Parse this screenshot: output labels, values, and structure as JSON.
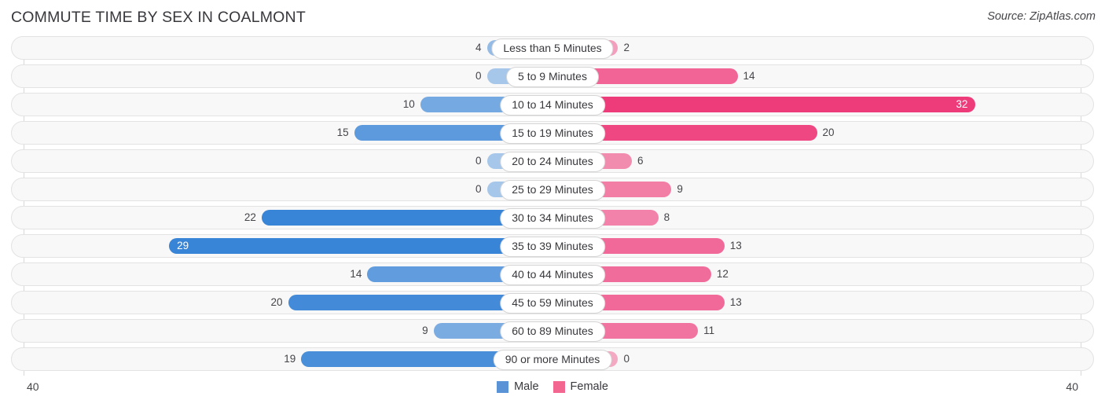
{
  "header": {
    "title": "COMMUTE TIME BY SEX IN COALMONT",
    "source": "Source: ZipAtlas.com"
  },
  "axis": {
    "left_tick": "40",
    "right_tick": "40",
    "max": 40
  },
  "legend": {
    "items": [
      {
        "label": "Male",
        "color": "#5b94d6",
        "swatch": "male-swatch"
      },
      {
        "label": "Female",
        "color": "#f2668f",
        "swatch": "female-swatch"
      }
    ]
  },
  "colors": {
    "male": "#6fa3dd",
    "female": "#f4769f",
    "male_strong": "#5b94d6",
    "female_strong": "#f2548b",
    "track": "#f8f8f8",
    "track_border": "#e3e3e3",
    "axis_line": "#d8d8d8",
    "text": "#45454a"
  },
  "chart_data": {
    "type": "bar",
    "orientation": "horizontal-diverging",
    "title": "COMMUTE TIME BY SEX IN COALMONT",
    "xlabel": "",
    "ylabel": "",
    "xlim": [
      40,
      40
    ],
    "grid": false,
    "legend_position": "bottom-center",
    "categories": [
      "Less than 5 Minutes",
      "5 to 9 Minutes",
      "10 to 14 Minutes",
      "15 to 19 Minutes",
      "20 to 24 Minutes",
      "25 to 29 Minutes",
      "30 to 34 Minutes",
      "35 to 39 Minutes",
      "40 to 44 Minutes",
      "45 to 59 Minutes",
      "60 to 89 Minutes",
      "90 or more Minutes"
    ],
    "series": [
      {
        "name": "Male",
        "color": "#5b94d6",
        "values": [
          4,
          0,
          10,
          15,
          0,
          0,
          22,
          29,
          14,
          20,
          9,
          19
        ]
      },
      {
        "name": "Female",
        "color": "#f2668f",
        "values": [
          2,
          14,
          32,
          20,
          6,
          9,
          8,
          13,
          12,
          13,
          11,
          0
        ]
      }
    ]
  },
  "rows": [
    {
      "category": "Less than 5 Minutes",
      "male": 4,
      "female": 2,
      "male_text": "4",
      "female_text": "2",
      "male_inside": false,
      "female_inside": false
    },
    {
      "category": "5 to 9 Minutes",
      "male": 0,
      "female": 14,
      "male_text": "0",
      "female_text": "14",
      "male_inside": false,
      "female_inside": false
    },
    {
      "category": "10 to 14 Minutes",
      "male": 10,
      "female": 32,
      "male_text": "10",
      "female_text": "32",
      "male_inside": false,
      "female_inside": true
    },
    {
      "category": "15 to 19 Minutes",
      "male": 15,
      "female": 20,
      "male_text": "15",
      "female_text": "20",
      "male_inside": false,
      "female_inside": false
    },
    {
      "category": "20 to 24 Minutes",
      "male": 0,
      "female": 6,
      "male_text": "0",
      "female_text": "6",
      "male_inside": false,
      "female_inside": false
    },
    {
      "category": "25 to 29 Minutes",
      "male": 0,
      "female": 9,
      "male_text": "0",
      "female_text": "9",
      "male_inside": false,
      "female_inside": false
    },
    {
      "category": "30 to 34 Minutes",
      "male": 22,
      "female": 8,
      "male_text": "22",
      "female_text": "8",
      "male_inside": false,
      "female_inside": false
    },
    {
      "category": "35 to 39 Minutes",
      "male": 29,
      "female": 13,
      "male_text": "29",
      "female_text": "13",
      "male_inside": true,
      "female_inside": false
    },
    {
      "category": "40 to 44 Minutes",
      "male": 14,
      "female": 12,
      "male_text": "14",
      "female_text": "12",
      "male_inside": false,
      "female_inside": false
    },
    {
      "category": "45 to 59 Minutes",
      "male": 20,
      "female": 13,
      "male_text": "20",
      "female_text": "13",
      "male_inside": false,
      "female_inside": false
    },
    {
      "category": "60 to 89 Minutes",
      "male": 9,
      "female": 11,
      "male_text": "9",
      "female_text": "11",
      "male_inside": false,
      "female_inside": false
    },
    {
      "category": "90 or more Minutes",
      "male": 19,
      "female": 0,
      "male_text": "19",
      "female_text": "0",
      "male_inside": false,
      "female_inside": false
    }
  ]
}
